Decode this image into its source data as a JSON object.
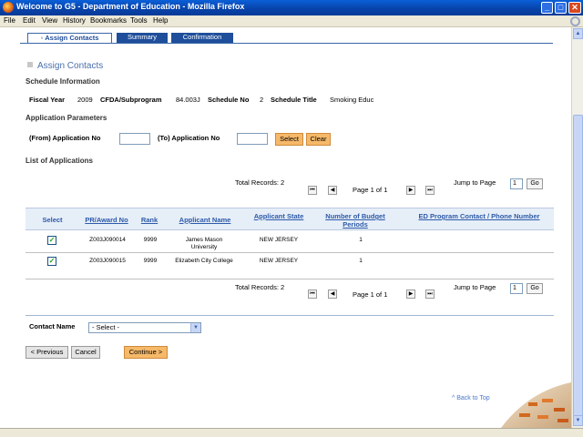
{
  "window": {
    "title": "Welcome to G5 - Department of Education - Mozilla Firefox"
  },
  "menu": [
    "File",
    "Edit",
    "View",
    "History",
    "Bookmarks",
    "Tools",
    "Help"
  ],
  "tabs": [
    {
      "label": "Assign Contacts",
      "active": true
    },
    {
      "label": "Summary",
      "active": false
    },
    {
      "label": "Confirmation",
      "active": false
    }
  ],
  "page": {
    "heading": "Assign Contacts"
  },
  "schedule_info": {
    "section_title": "Schedule Information",
    "fiscal_year_label": "Fiscal Year",
    "fiscal_year": "2009",
    "cfda_label": "CFDA/Subprogram",
    "cfda": "84.003J",
    "schedule_no_label": "Schedule No",
    "schedule_no": "2",
    "schedule_title_label": "Schedule Title",
    "schedule_title": "Smoking Educ"
  },
  "app_params": {
    "section_title": "Application Parameters",
    "from_label": "(From) Application No",
    "to_label": "(To) Application No",
    "from_value": "",
    "to_value": "",
    "select_button": "Select",
    "clear_button": "Clear"
  },
  "list": {
    "section_title": "List of Applications",
    "total_records": "Total Records: 2",
    "page_text": "Page 1 of 1",
    "jump_label": "Jump to Page",
    "jump_value": "1",
    "go_button": "Go"
  },
  "table": {
    "headers": [
      "Select",
      "PR/Award No",
      "Rank",
      "Applicant Name",
      "Applicant State",
      "Number of Budget Periods",
      "ED Program Contact / Phone Number"
    ],
    "rows": [
      {
        "checked": true,
        "award": "Z003J090014",
        "rank": "9999",
        "name": "James Mason University",
        "state": "NEW JERSEY",
        "budget_periods": "1",
        "contact": ""
      },
      {
        "checked": true,
        "award": "Z003J090015",
        "rank": "9999",
        "name": "Elizabeth City College",
        "state": "NEW JERSEY",
        "budget_periods": "1",
        "contact": ""
      }
    ]
  },
  "contact": {
    "label": "Contact Name",
    "selected": "- Select -"
  },
  "actions": {
    "previous": "< Previous",
    "cancel": "Cancel",
    "continue": "Continue >"
  },
  "footer": {
    "back_to_top": "^ Back to Top"
  },
  "colors": {
    "accent_blue": "#1f4f9b",
    "button_orange": "#f6b96a",
    "header_link": "#2d5aa8"
  }
}
